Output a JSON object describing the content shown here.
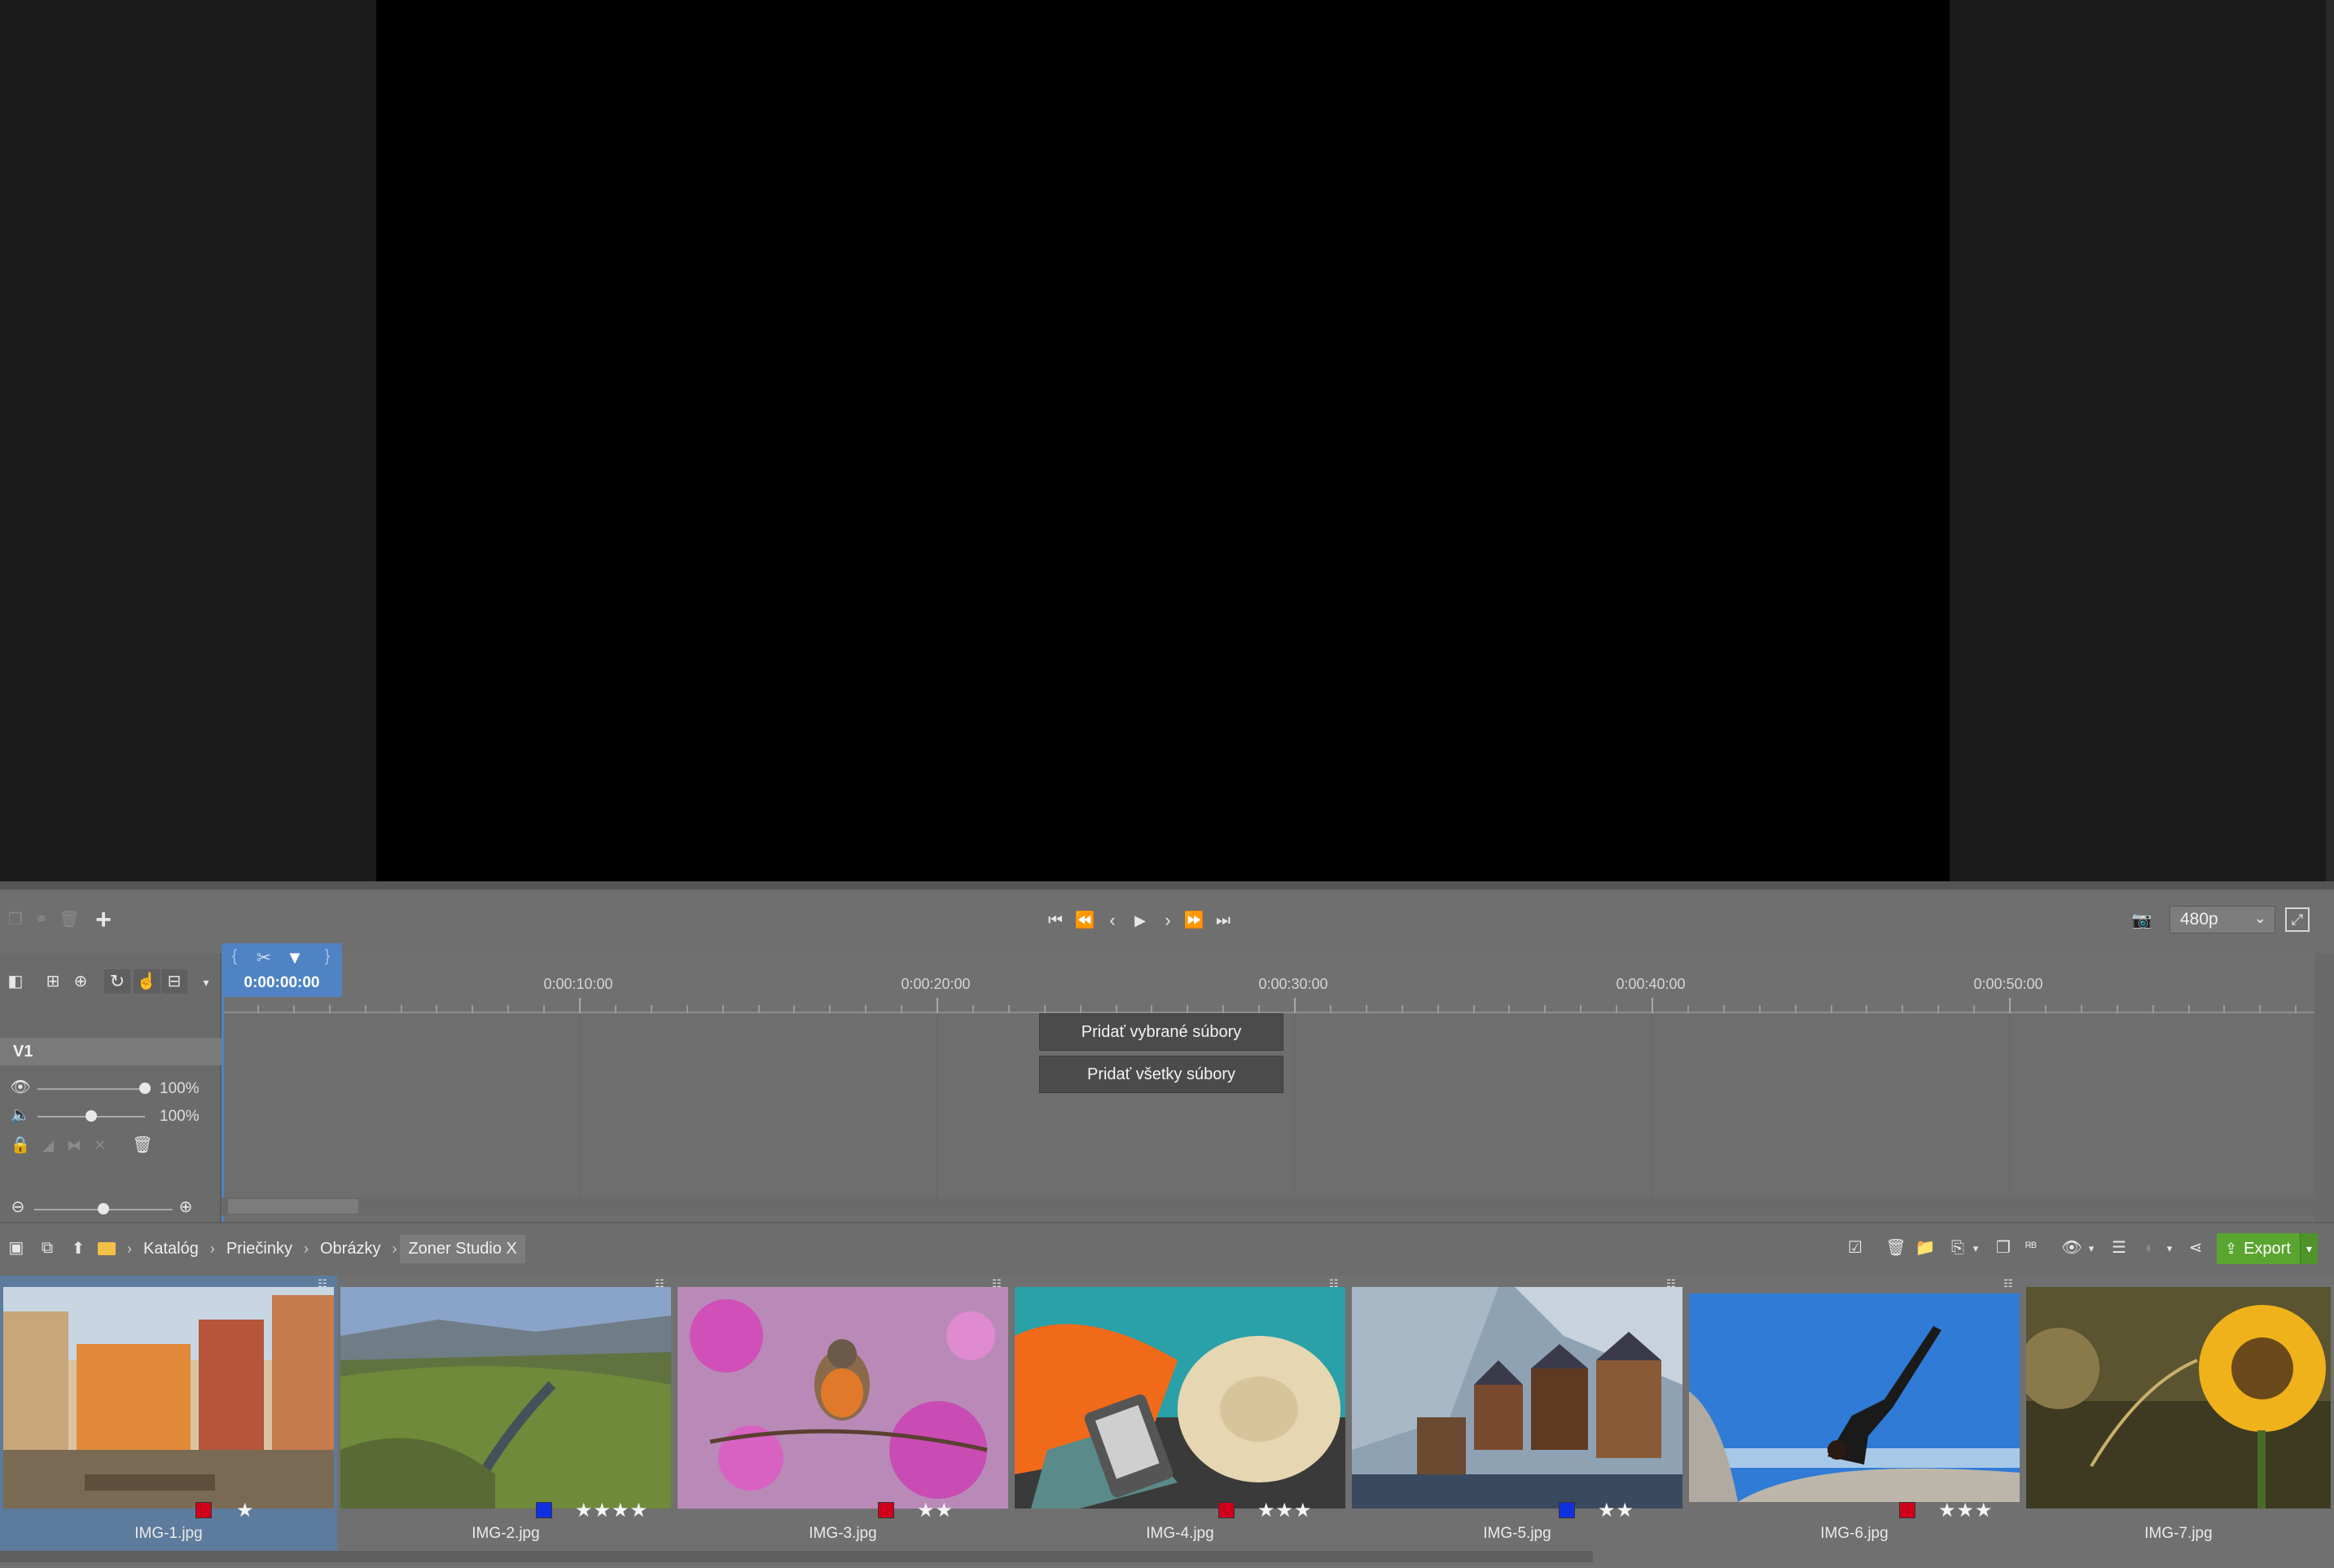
{
  "player": {
    "resolution": "480p"
  },
  "timeline": {
    "current_time": "0:00:00:00",
    "ticks": [
      "0:00:10:00",
      "0:00:20:00",
      "0:00:30:00",
      "0:00:40:00",
      "0:00:50:00"
    ],
    "track": {
      "label": "V1",
      "visibility_pct": "100%",
      "volume_pct": "100%",
      "visibility_level": 1.0,
      "volume_level": 0.5
    },
    "add_selected_label": "Pridať vybrané súbory",
    "add_all_label": "Pridať všetky súbory"
  },
  "browser": {
    "breadcrumb": [
      "Katalóg",
      "Priečinky",
      "Obrázky",
      "Zoner Studio X"
    ],
    "export_label": "Export"
  },
  "colors": {
    "red_label": "#d0001a",
    "blue_label": "#1030e0",
    "export_green": "#5aa530",
    "selection_blue": "#5d7b9c",
    "playhead_blue": "#4f83c3"
  },
  "files": [
    {
      "name": "IMG-1.jpg",
      "label": "red",
      "stars": 1,
      "selected": true
    },
    {
      "name": "IMG-2.jpg",
      "label": "blue",
      "stars": 4,
      "selected": false
    },
    {
      "name": "IMG-3.jpg",
      "label": "red",
      "stars": 2,
      "selected": false
    },
    {
      "name": "IMG-4.jpg",
      "label": "red",
      "stars": 3,
      "selected": false
    },
    {
      "name": "IMG-5.jpg",
      "label": "blue",
      "stars": 2,
      "selected": false
    },
    {
      "name": "IMG-6.jpg",
      "label": "red",
      "stars": 3,
      "selected": false
    },
    {
      "name": "IMG-7.jpg",
      "label": "none",
      "stars": 0,
      "selected": false
    }
  ]
}
